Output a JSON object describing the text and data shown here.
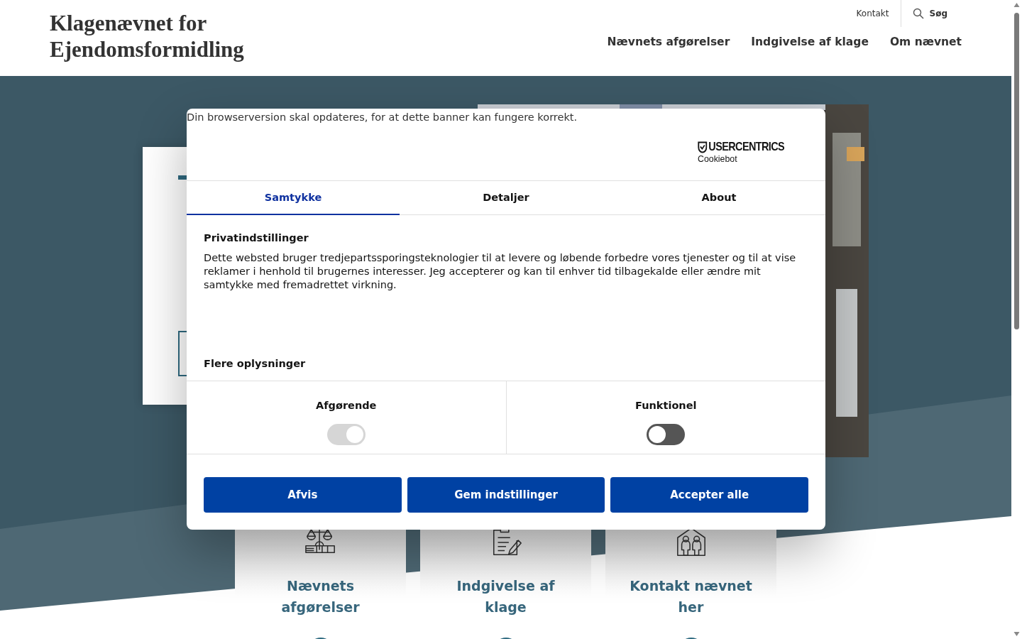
{
  "header": {
    "logo": "Klagenævnet for Ejendomsformidling",
    "utility_links": [
      {
        "label": "Kontakt",
        "kind": "link"
      },
      {
        "label": "Søg",
        "kind": "search"
      }
    ],
    "nav": [
      "Nævnets afgørelser",
      "Indgivelse af klage",
      "Om nævnet"
    ]
  },
  "cards": [
    {
      "kind": "scales",
      "title": "Nævnets afgørelser"
    },
    {
      "kind": "document",
      "title": "Indgivelse af klage"
    },
    {
      "kind": "people",
      "title": "Kontakt nævnet her"
    }
  ],
  "cookie_banner": {
    "browser_notice": "Din browserversion skal opdateres, for at dette banner kan fungere korrekt.",
    "brand": {
      "name": "USERCENTRICS",
      "product": "Cookiebot"
    },
    "tabs": [
      {
        "label": "Samtykke",
        "selected": true
      },
      {
        "label": "Detaljer",
        "selected": false
      },
      {
        "label": "About",
        "selected": false
      }
    ],
    "heading": "Privatindstillinger",
    "text": "Dette websted bruger tredjepartssporingsteknologier til at levere og løbende forbedre vores tjenester og til at vise reklamer i henhold til brugernes interesser. Jeg accepterer og kan til enhver tid tilbagekalde eller ændre mit samtykke med fremadrettet virkning.",
    "more_heading": "Flere oplysninger",
    "categories": [
      {
        "label": "Afgørende",
        "on": true,
        "disabled": true
      },
      {
        "label": "Funktionel",
        "on": false,
        "disabled": false
      }
    ],
    "buttons": [
      "Afvis",
      "Gem indstillinger",
      "Accepter alle"
    ]
  }
}
